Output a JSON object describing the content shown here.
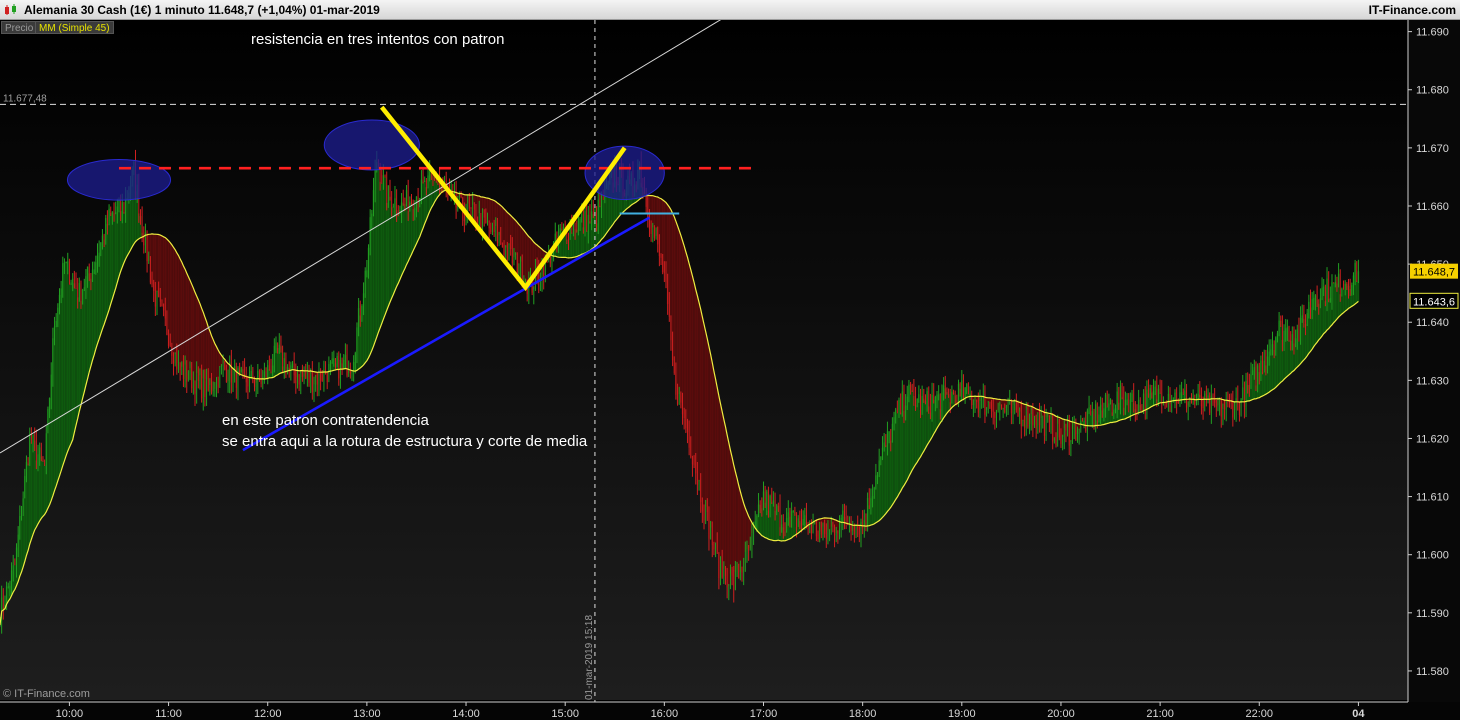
{
  "window": {
    "title": "Alemania 30 Cash (1€)    1 minuto    11.648,7 (+1,04%)    01-mar-2019",
    "brand": "IT-Finance.com"
  },
  "legend": {
    "price_label": "Precio",
    "ma_label": "MM (Simple 45)"
  },
  "annotations": {
    "top_note": "resistencia en tres intentos con patron",
    "bottom_note_line1": "en este patron contratendencia",
    "bottom_note_line2": "se entra aqui a la rotura de estructura y corte de media"
  },
  "watermark": "© IT-Finance.com",
  "colors": {
    "background": "#000000",
    "up_candle": "#22a022",
    "down_candle": "#d02020",
    "fill_above": "#0e5a0e",
    "fill_below": "#5a0c0c",
    "moving_average": "#f0ee40",
    "resistance": "#ff2020",
    "trendline": "#1a1aff",
    "diagonal": "#d8d8d8",
    "pattern": "#ffee00",
    "breakout": "#40b0e0",
    "circles": "#1c1c8c",
    "last_price_label": "#f5d000"
  },
  "chart_data": {
    "type": "candlestick",
    "timeframe": "1 minuto",
    "symbol": "Alemania 30 Cash (1€)",
    "y_ticks": [
      "11.690",
      "11.680",
      "11.670",
      "11.660",
      "11.650",
      "11.640",
      "11.630",
      "11.620",
      "11.610",
      "11.600",
      "11.590",
      "11.580"
    ],
    "ylim": [
      11575,
      11692
    ],
    "x_ticks": [
      "10:00",
      "11:00",
      "12:00",
      "13:00",
      "14:00",
      "15:00",
      "16:00",
      "17:00",
      "18:00",
      "19:00",
      "20:00",
      "21:00",
      "22:00",
      "04"
    ],
    "x_tick_hours": [
      10,
      11,
      12,
      13,
      14,
      15,
      16,
      17,
      18,
      19,
      20,
      21,
      22,
      23
    ],
    "x_range_hours": [
      9.3,
      23.5
    ],
    "reference_level": {
      "label": "11.677,48",
      "value": 11677.48
    },
    "crosshair": {
      "time_hours": 15.3,
      "label": "01-mar-2019 15:18"
    },
    "last_price": {
      "label": "11.648,7",
      "value": 11648.7
    },
    "ma_value": {
      "label": "11.643,6",
      "value": 11643.6
    },
    "moving_average": {
      "name": "MM (Simple 45)"
    },
    "price_path": [
      [
        9.3,
        11590
      ],
      [
        9.45,
        11598
      ],
      [
        9.6,
        11620
      ],
      [
        9.75,
        11615
      ],
      [
        9.85,
        11640
      ],
      [
        9.95,
        11650
      ],
      [
        10.1,
        11645
      ],
      [
        10.25,
        11650
      ],
      [
        10.4,
        11658
      ],
      [
        10.55,
        11660
      ],
      [
        10.65,
        11666
      ],
      [
        10.75,
        11655
      ],
      [
        10.85,
        11645
      ],
      [
        11.0,
        11638
      ],
      [
        11.1,
        11632
      ],
      [
        11.25,
        11630
      ],
      [
        11.4,
        11628
      ],
      [
        11.55,
        11632
      ],
      [
        11.75,
        11630
      ],
      [
        11.95,
        11630
      ],
      [
        12.1,
        11635
      ],
      [
        12.25,
        11631
      ],
      [
        12.45,
        11630
      ],
      [
        12.65,
        11632
      ],
      [
        12.85,
        11633
      ],
      [
        13.0,
        11650
      ],
      [
        13.1,
        11668
      ],
      [
        13.2,
        11662
      ],
      [
        13.35,
        11660
      ],
      [
        13.5,
        11662
      ],
      [
        13.7,
        11665
      ],
      [
        13.9,
        11660
      ],
      [
        14.1,
        11658
      ],
      [
        14.3,
        11655
      ],
      [
        14.5,
        11650
      ],
      [
        14.65,
        11646
      ],
      [
        14.8,
        11650
      ],
      [
        14.95,
        11655
      ],
      [
        15.1,
        11657
      ],
      [
        15.3,
        11658
      ],
      [
        15.5,
        11666
      ],
      [
        15.65,
        11663
      ],
      [
        15.75,
        11667
      ],
      [
        15.85,
        11658
      ],
      [
        16.0,
        11648
      ],
      [
        16.1,
        11630
      ],
      [
        16.25,
        11620
      ],
      [
        16.4,
        11608
      ],
      [
        16.55,
        11598
      ],
      [
        16.7,
        11595
      ],
      [
        16.85,
        11600
      ],
      [
        17.0,
        11610
      ],
      [
        17.2,
        11606
      ],
      [
        17.4,
        11606
      ],
      [
        17.6,
        11603
      ],
      [
        17.8,
        11606
      ],
      [
        18.0,
        11605
      ],
      [
        18.15,
        11615
      ],
      [
        18.3,
        11622
      ],
      [
        18.45,
        11628
      ],
      [
        18.6,
        11626
      ],
      [
        18.8,
        11627
      ],
      [
        19.0,
        11628
      ],
      [
        19.2,
        11626
      ],
      [
        19.4,
        11625
      ],
      [
        19.6,
        11624
      ],
      [
        19.8,
        11623
      ],
      [
        20.0,
        11620
      ],
      [
        20.2,
        11622
      ],
      [
        20.4,
        11625
      ],
      [
        20.6,
        11627
      ],
      [
        20.8,
        11626
      ],
      [
        21.0,
        11628
      ],
      [
        21.2,
        11627
      ],
      [
        21.4,
        11626
      ],
      [
        21.6,
        11625
      ],
      [
        21.8,
        11626
      ],
      [
        22.0,
        11632
      ],
      [
        22.2,
        11639
      ],
      [
        22.4,
        11638
      ],
      [
        22.55,
        11645
      ],
      [
        22.75,
        11646
      ],
      [
        22.95,
        11648
      ],
      [
        23.0,
        11648.7
      ]
    ],
    "annotation_shapes": {
      "resistance_level": {
        "value": 11666.5,
        "from_hours": 10.5,
        "to_hours": 16.95
      },
      "trendline": {
        "from": [
          11.75,
          11618
        ],
        "to": [
          15.85,
          11658
        ]
      },
      "diagonal": {
        "from": [
          9.3,
          11617.5
        ],
        "to": [
          17.05,
          11697
        ]
      },
      "pattern_v": [
        [
          13.15,
          11677
        ],
        [
          14.6,
          11646
        ],
        [
          15.6,
          11670
        ]
      ],
      "breakout_line": {
        "value": 11658.7,
        "from_hours": 15.55,
        "to_hours": 16.15
      },
      "circles": [
        {
          "center": [
            10.5,
            11664.5
          ],
          "radius_hours": 0.52,
          "radius_price": 3.5
        },
        {
          "center": [
            13.05,
            11670.5
          ],
          "radius_hours": 0.48,
          "radius_price": 4.3
        },
        {
          "center": [
            15.6,
            11665.7
          ],
          "radius_hours": 0.4,
          "radius_price": 4.6
        }
      ]
    }
  }
}
